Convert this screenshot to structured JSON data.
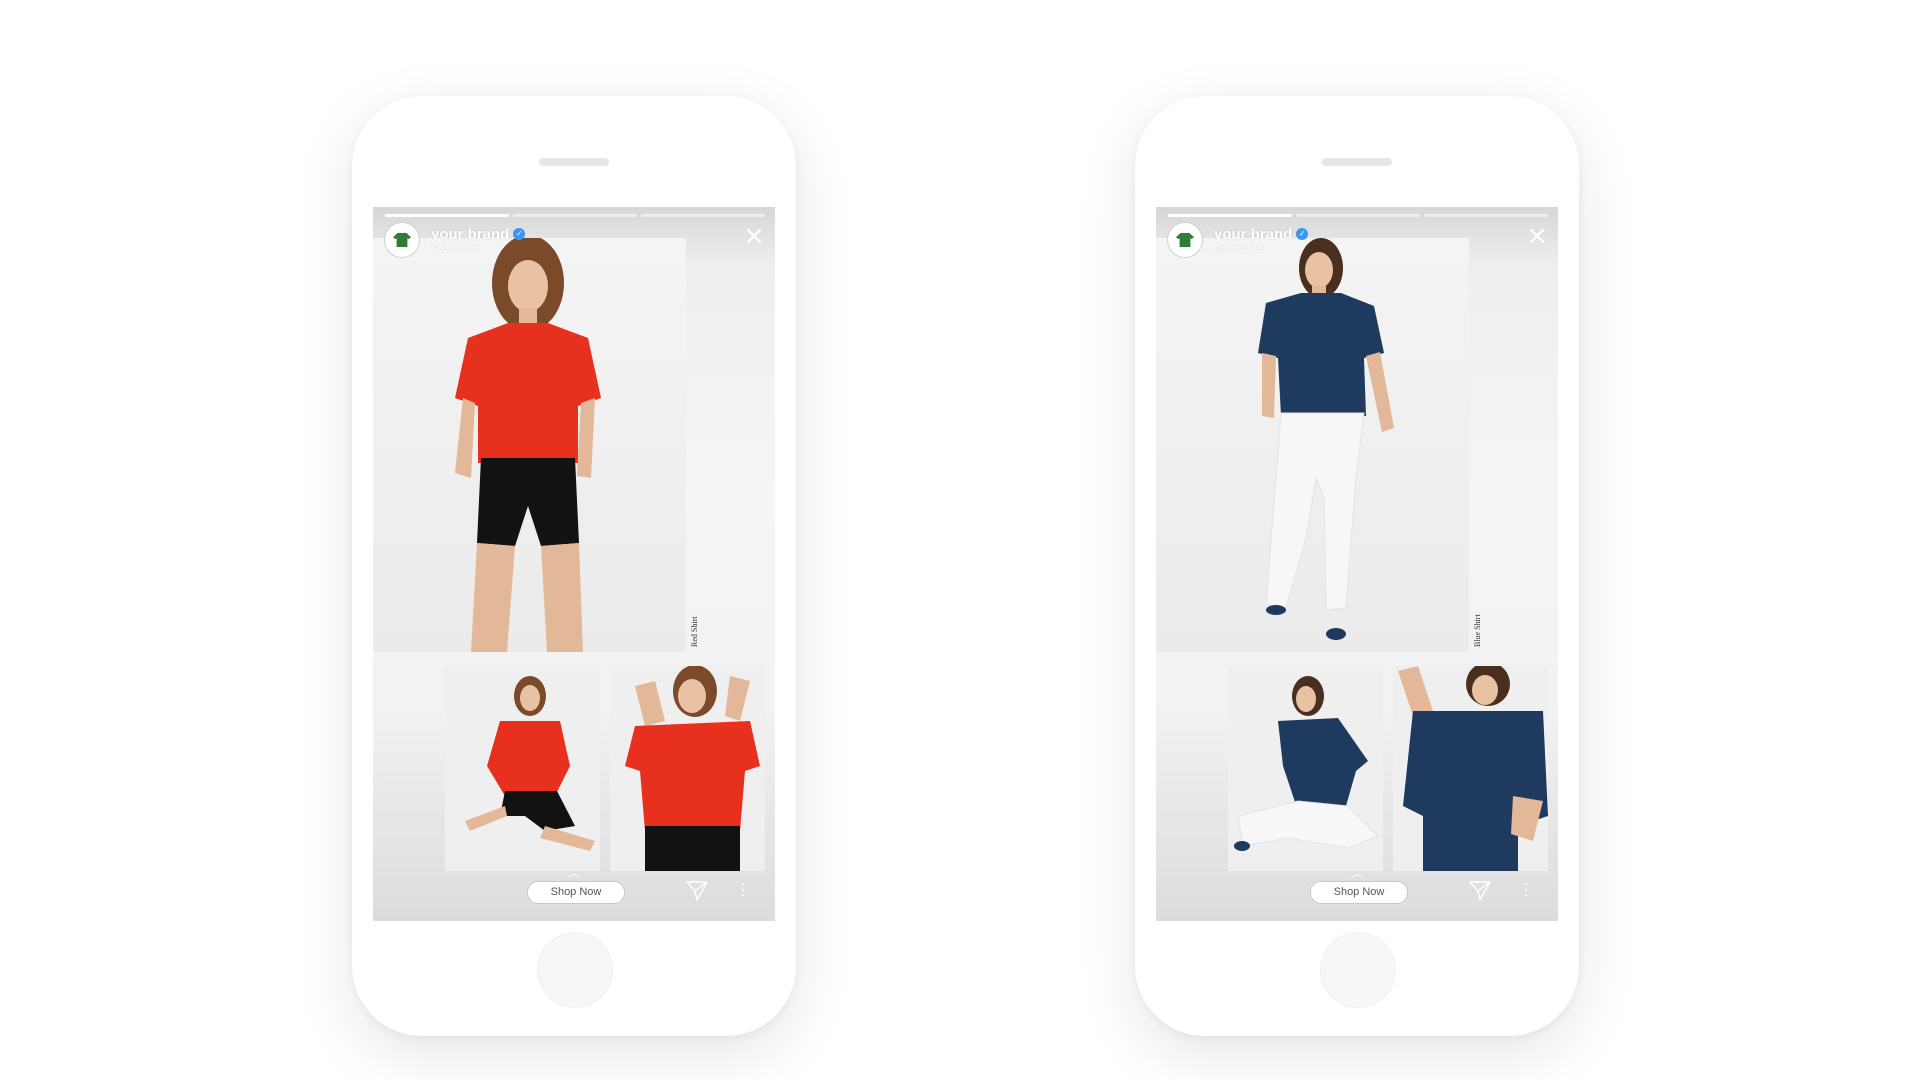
{
  "phones": [
    {
      "id": "left",
      "brand_name": "your brand",
      "sponsored": "Sponsored",
      "photo_label": "Red Shirt",
      "cta": "Shop Now",
      "shirt_color": "#e8301f",
      "bottom_color": "#121212",
      "photo_theme": "red"
    },
    {
      "id": "right",
      "brand_name": "your brand",
      "sponsored": "Sponsored",
      "photo_label": "Blue Shirt",
      "cta": "Shop Now",
      "shirt_color": "#1e3a5f",
      "bottom_color": "#f4f4f4",
      "photo_theme": "blue"
    }
  ],
  "icons": {
    "close": "close-icon",
    "verified": "verified-badge-icon",
    "send": "send-icon",
    "more": "more-icon",
    "swipe_up": "chevron-up-icon"
  },
  "colors": {
    "verified": "#3897f0",
    "brand_avatar_shirt": "#2e7d32"
  }
}
